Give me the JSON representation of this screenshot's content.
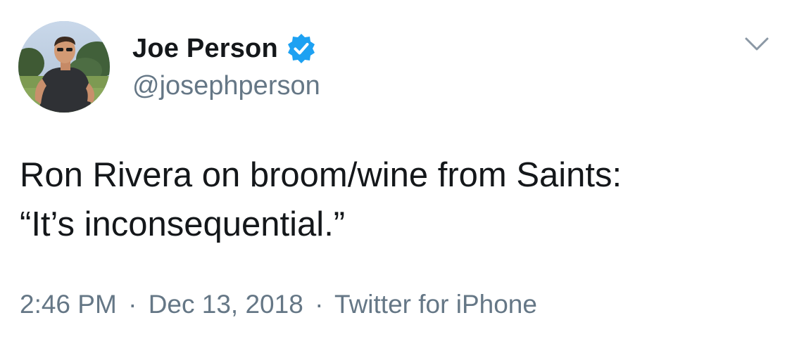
{
  "author": {
    "display_name": "Joe Person",
    "handle": "@josephperson",
    "verified": true
  },
  "tweet": {
    "text_lines": [
      "Ron Rivera on broom/wine from Saints:",
      "“It’s inconsequential.”"
    ]
  },
  "meta": {
    "time": "2:46 PM",
    "separator": "·",
    "date": "Dec 13, 2018",
    "source": "Twitter for iPhone"
  },
  "icons": {
    "verified": "verified-badge-icon",
    "more": "chevron-down-icon"
  },
  "colors": {
    "primary_text": "#14171a",
    "secondary_text": "#657786",
    "verified_blue": "#1da1f2"
  }
}
